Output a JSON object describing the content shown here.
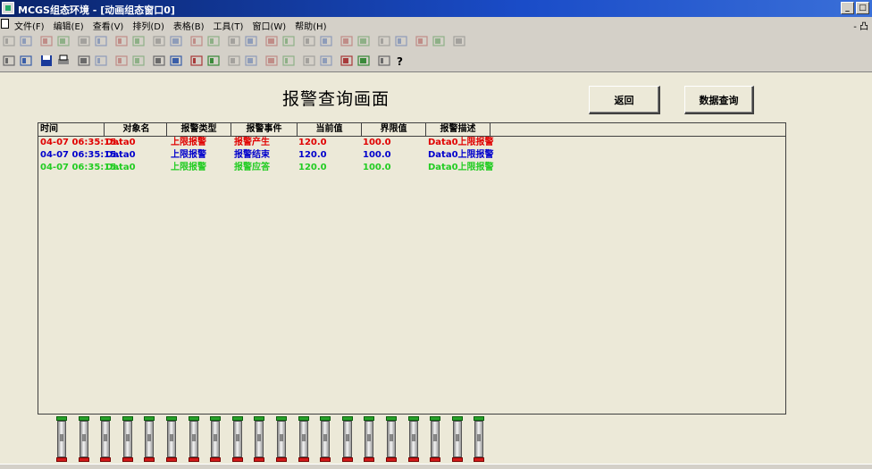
{
  "window": {
    "title": "MCGS组态环境 - [动画组态窗口0]"
  },
  "menu": {
    "items": [
      "文件(F)",
      "编辑(E)",
      "查看(V)",
      "排列(D)",
      "表格(B)",
      "工具(T)",
      "窗口(W)",
      "帮助(H)"
    ],
    "mdi_controls": "- 凸"
  },
  "screen": {
    "title": "报警查询画面",
    "return_label": "返回",
    "query_label": "数据查询"
  },
  "table": {
    "columns": [
      "时间",
      "对象名",
      "报警类型",
      "报警事件",
      "当前值",
      "界限值",
      "报警描述"
    ],
    "rows": [
      {
        "color": "#e00000",
        "cells": [
          "04-07 06:35:15.",
          "Data0",
          "上限报警",
          "报警产生",
          "120.0",
          "100.0",
          "Data0上限报警"
        ]
      },
      {
        "color": "#0000cc",
        "cells": [
          "04-07 06:35:15.",
          "Data0",
          "上限报警",
          "报警结束",
          "120.0",
          "100.0",
          "Data0上限报警"
        ]
      },
      {
        "color": "#22cc22",
        "cells": [
          "04-07 06:35:15.",
          "Data0",
          "上限报警",
          "报警应答",
          "120.0",
          "100.0",
          "Data0上限报警"
        ]
      }
    ]
  },
  "colors": {
    "alarm_raised": "#e00000",
    "alarm_ended": "#0000cc",
    "alarm_acked": "#22cc22",
    "titlebar": "#0a246a",
    "workspace": "#ece9d8"
  },
  "toolbar": {
    "row1_icons": [
      "align-left-icon",
      "align-right-icon",
      "align-top-icon",
      "align-bottom-icon",
      "center-h-icon",
      "center-v-icon",
      "same-width-icon",
      "same-height-icon",
      "same-size-icon",
      "h-space-icon",
      "v-space-icon",
      "grid-icon",
      "rotate-left-icon",
      "rotate-right-icon",
      "flip-h-icon",
      "flip-v-icon",
      "group-icon",
      "ungroup-icon",
      "bring-front-icon",
      "send-back-icon",
      "forward-icon",
      "backward-icon",
      "lock-icon",
      "unlock-icon",
      "fix-icon"
    ],
    "row2_icons": [
      "new-window-icon",
      "open-icon",
      "save-icon",
      "print-icon",
      "preview-icon",
      "cut-icon",
      "copy-icon",
      "paste-icon",
      "undo-icon",
      "redo-icon",
      "tools-icon",
      "select-icon",
      "line-icon",
      "rect-icon",
      "ellipse-icon",
      "text-icon",
      "label-icon",
      "table-icon",
      "properties-icon",
      "check-icon",
      "run-icon",
      "help-icon"
    ]
  },
  "tube_icons": 20
}
